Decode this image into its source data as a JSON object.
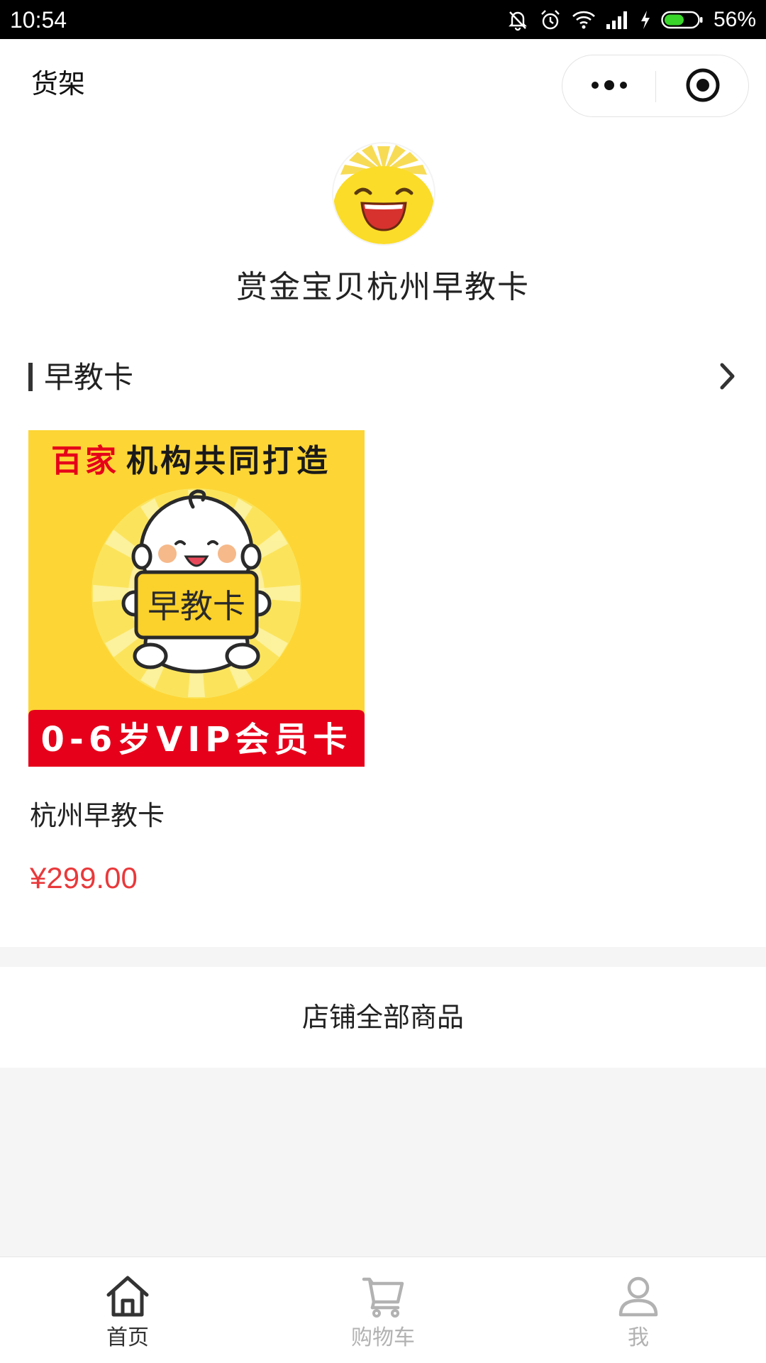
{
  "status_bar": {
    "time": "10:54",
    "battery_percent_label": "56%",
    "battery_level": 0.56,
    "icons": [
      "mute-bell-icon",
      "alarm-icon",
      "wifi-icon",
      "signal-icon",
      "charging-icon",
      "battery-icon"
    ]
  },
  "nav": {
    "title": "货架",
    "more_icon": "more-dots-icon",
    "close_icon": "target-close-icon"
  },
  "shop": {
    "name": "赏金宝贝杭州早教卡",
    "avatar_icon": "smiling-sun-logo"
  },
  "section": {
    "title": "早教卡",
    "arrow_icon": "chevron-right-icon"
  },
  "product": {
    "image": {
      "banner_red": "百家",
      "banner_black": "机构共同打造",
      "card_text": "早教卡",
      "footer_text": "0-6岁VIP会员卡"
    },
    "name": "杭州早教卡",
    "price": "¥299.00"
  },
  "all_products_label": "店铺全部商品",
  "tabbar": {
    "items": [
      {
        "label": "首页",
        "icon": "home-icon",
        "active": true
      },
      {
        "label": "购物车",
        "icon": "cart-icon",
        "active": false
      },
      {
        "label": "我",
        "icon": "user-icon",
        "active": false
      }
    ]
  },
  "colors": {
    "price_red": "#e9393b",
    "tab_active": "#333333",
    "tab_inactive": "#b2b2b2",
    "product_bg_yellow": "#fdd535",
    "product_footer_red": "#e6001a"
  }
}
